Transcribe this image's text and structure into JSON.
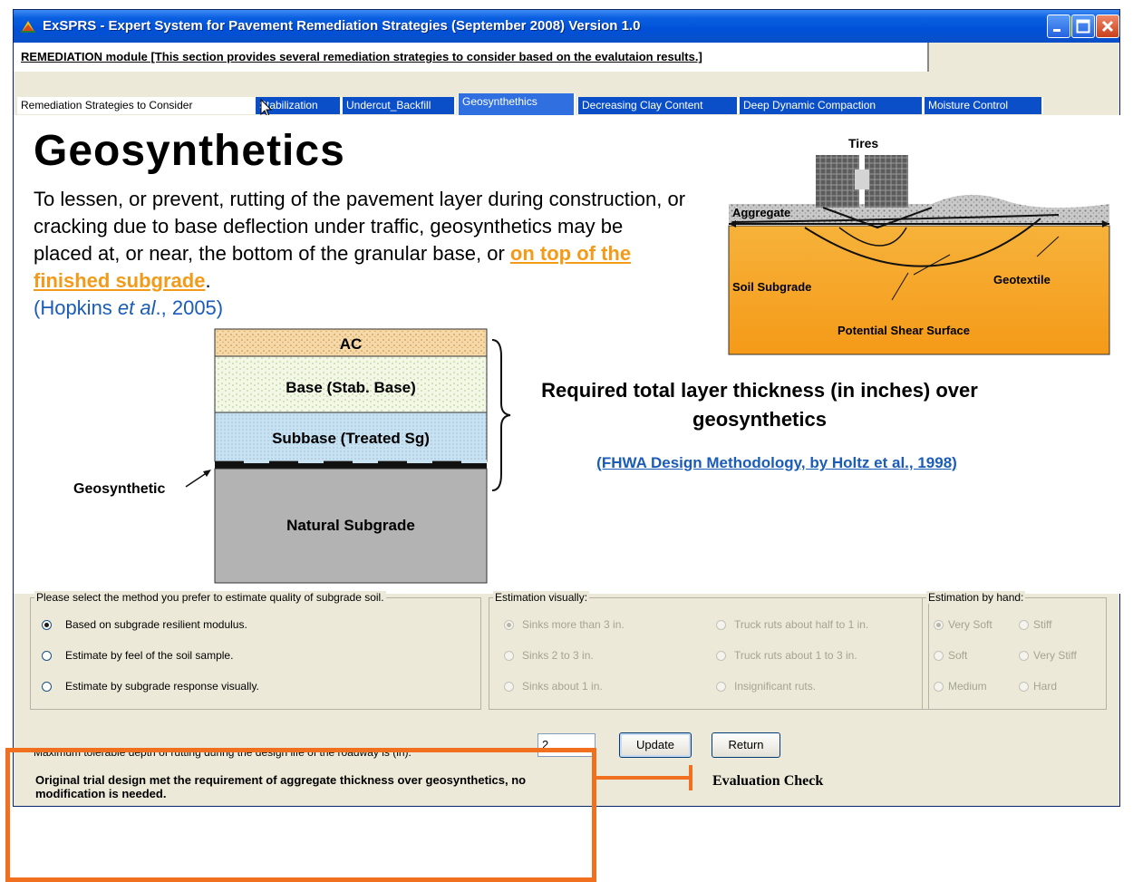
{
  "window": {
    "title": "ExSPRS - Expert System for Pavement Remediation Strategies (September 2008)  Version 1.0"
  },
  "module": {
    "text": "REMEDIATION module [This section provides several remediation strategies to consider based on the evalutaion results.]"
  },
  "tabs": [
    {
      "label": "Remediation Strategies to Consider"
    },
    {
      "label": "Stabilization"
    },
    {
      "label": "Undercut_Backfill"
    },
    {
      "label": "Geosynthethics"
    },
    {
      "label": "Decreasing Clay Content"
    },
    {
      "label": "Deep Dynamic Compaction"
    },
    {
      "label": "Moisture Control"
    }
  ],
  "content": {
    "heading": "Geosynthetics",
    "para_text": "To lessen, or prevent, rutting of the pavement layer during construction, or cracking due to base deflection under traffic, geosynthetics may be placed at, or near, the bottom of the granular base, or ",
    "para_link": "on top of the finished subgrade",
    "para_end": ".",
    "citation_prefix": "(Hopkins ",
    "citation_italic": "et al",
    "citation_suffix": "., 2005)",
    "tires_diagram": {
      "tires": "Tires",
      "aggregate": "Aggregate",
      "soil_subgrade": "Soil Subgrade",
      "geotextile": "Geotextile",
      "shear_surface": "Potential Shear Surface"
    },
    "layers": {
      "ac": "AC",
      "base": "Base (Stab. Base)",
      "subbase": "Subbase (Treated Sg)",
      "natural": "Natural Subgrade"
    },
    "geosynthetic_label": "Geosynthetic",
    "required_title": "Required total layer thickness (in inches) over geosynthetics",
    "fhwa_link": "(FHWA Design Methodology, by Holtz et al., 1998)"
  },
  "method_group": {
    "legend": "Please select the method you prefer to estimate quality of subgrade soil.",
    "options": [
      {
        "label": "Based on subgrade resilient modulus.",
        "selected": true
      },
      {
        "label": "Estimate by feel of the soil sample.",
        "selected": false
      },
      {
        "label": "Estimate by subgrade response visually.",
        "selected": false
      }
    ]
  },
  "visual_group": {
    "legend": "Estimation visually:",
    "options": [
      {
        "label": "Sinks more than 3 in.",
        "selected": true
      },
      {
        "label": "Truck ruts about half to 1 in.",
        "selected": false
      },
      {
        "label": "Sinks 2 to 3 in.",
        "selected": false
      },
      {
        "label": "Truck ruts about 1 to 3 in.",
        "selected": false
      },
      {
        "label": "Sinks about 1 in.",
        "selected": false
      },
      {
        "label": "Insignificant ruts.",
        "selected": false
      }
    ]
  },
  "hand_group": {
    "legend": "Estimation by hand:",
    "options": [
      {
        "label": "Very Soft",
        "selected": true
      },
      {
        "label": "Stiff",
        "selected": false
      },
      {
        "label": "Soft",
        "selected": false
      },
      {
        "label": "Very Stiff",
        "selected": false
      },
      {
        "label": "Medium",
        "selected": false
      },
      {
        "label": "Hard",
        "selected": false
      }
    ]
  },
  "rutting": {
    "label": "Maximum tolerable depth of rutting during the design life of the roadway is (in):",
    "value": "2",
    "update_label": "Update",
    "return_label": "Return"
  },
  "status": "Original trial design met the requirement of aggregate thickness over geosynthetics, no modification is needed.",
  "annotation": {
    "label": "Evaluation Check",
    "color": "#f07020"
  }
}
